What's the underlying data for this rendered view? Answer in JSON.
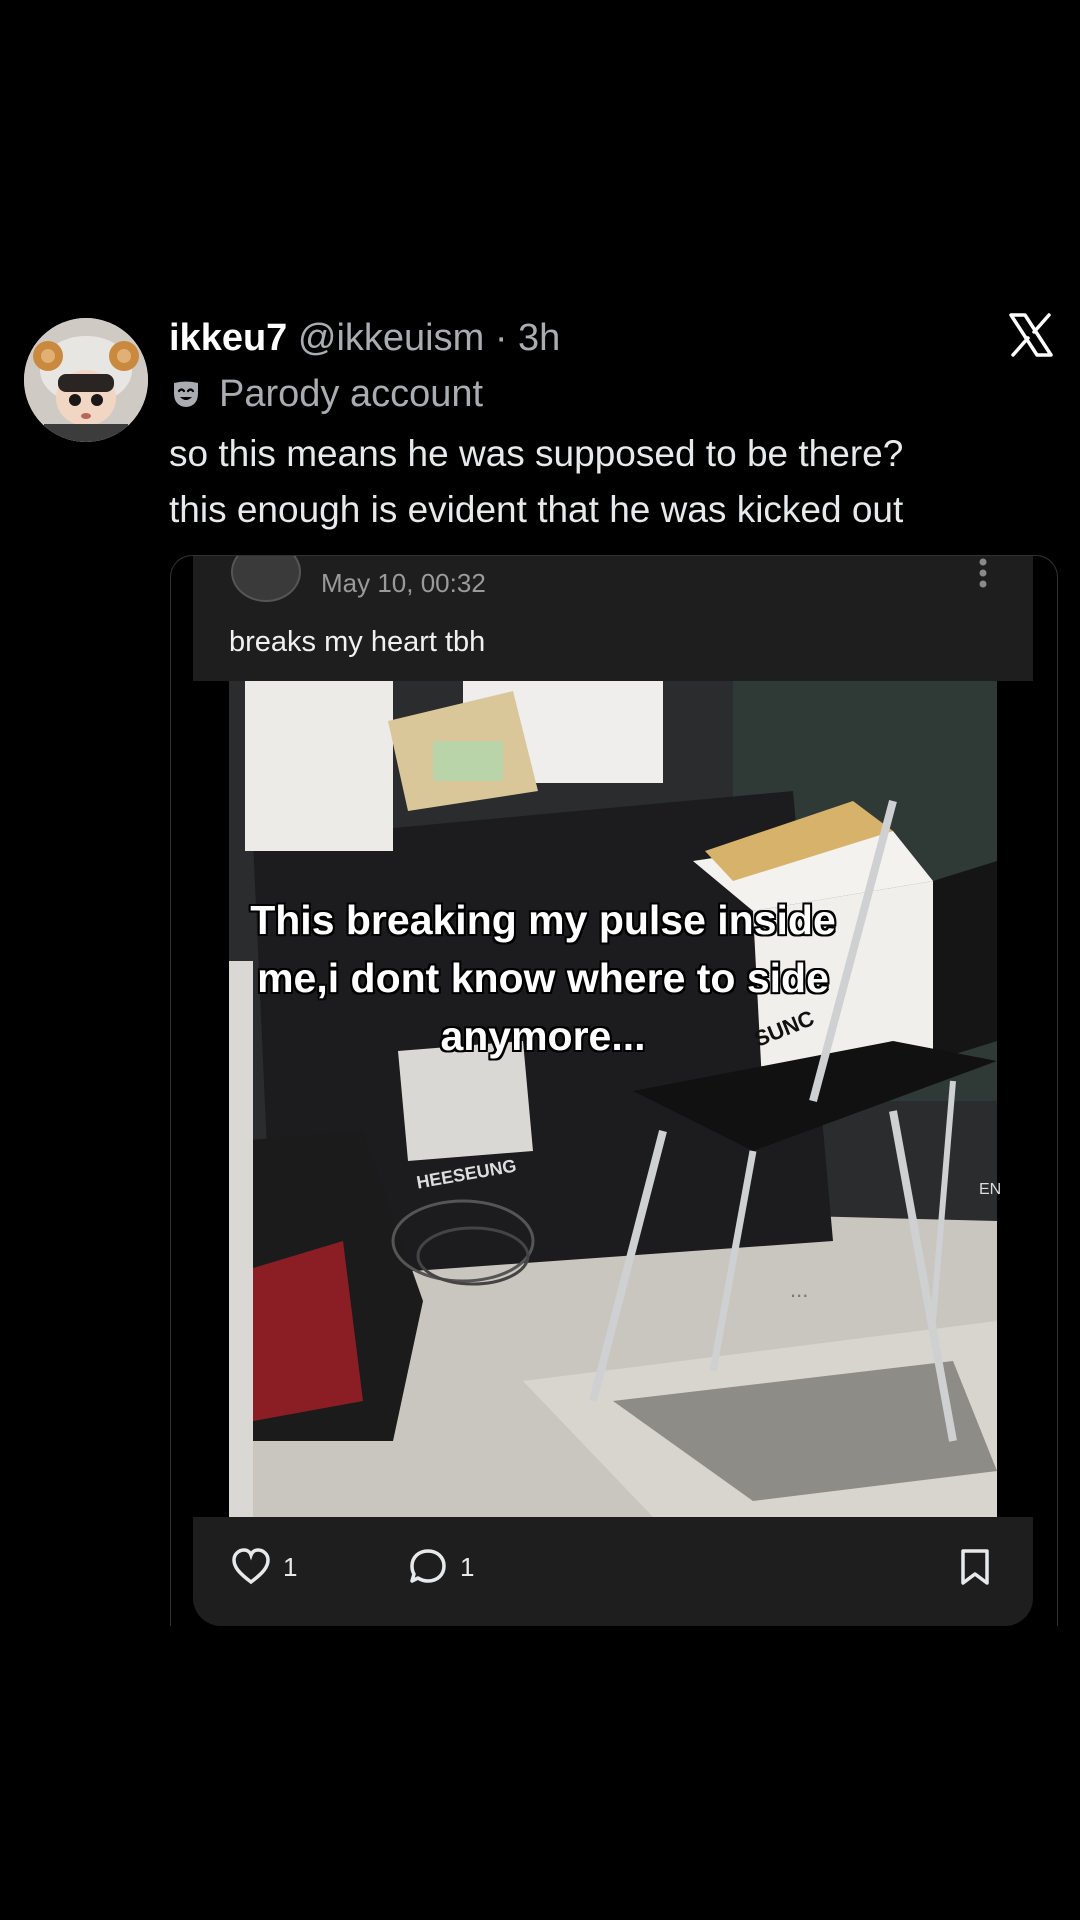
{
  "tweet": {
    "display_name": "ikkeu7",
    "handle": "@ikkeuism",
    "separator": " · ",
    "time": "3h",
    "parody_label": "Parody account",
    "text_lines": [
      "so this means he was supposed to be there?",
      "this enough is evident that he was kicked out"
    ]
  },
  "quoted": {
    "date": "May 10, 00:32",
    "text": "breaks my heart tbh",
    "caption_lines": [
      "This breaking my pulse inside",
      "me,i dont know where to side",
      "anymore..."
    ],
    "photo_labels": {
      "box_text": "SUNC",
      "sign_text": "HEESEUNG",
      "side_text": "EN"
    },
    "likes": "1",
    "replies": "1",
    "side_dots": "..."
  },
  "icons": {
    "x_logo": "x-logo-icon",
    "parody": "theater-mask-icon",
    "like": "heart-icon",
    "reply": "comment-icon",
    "bookmark": "bookmark-icon",
    "more": "vertical-dots-icon"
  },
  "colors": {
    "background": "#000000",
    "card": "#1e1e1e",
    "muted_text": "#a9acb0"
  }
}
